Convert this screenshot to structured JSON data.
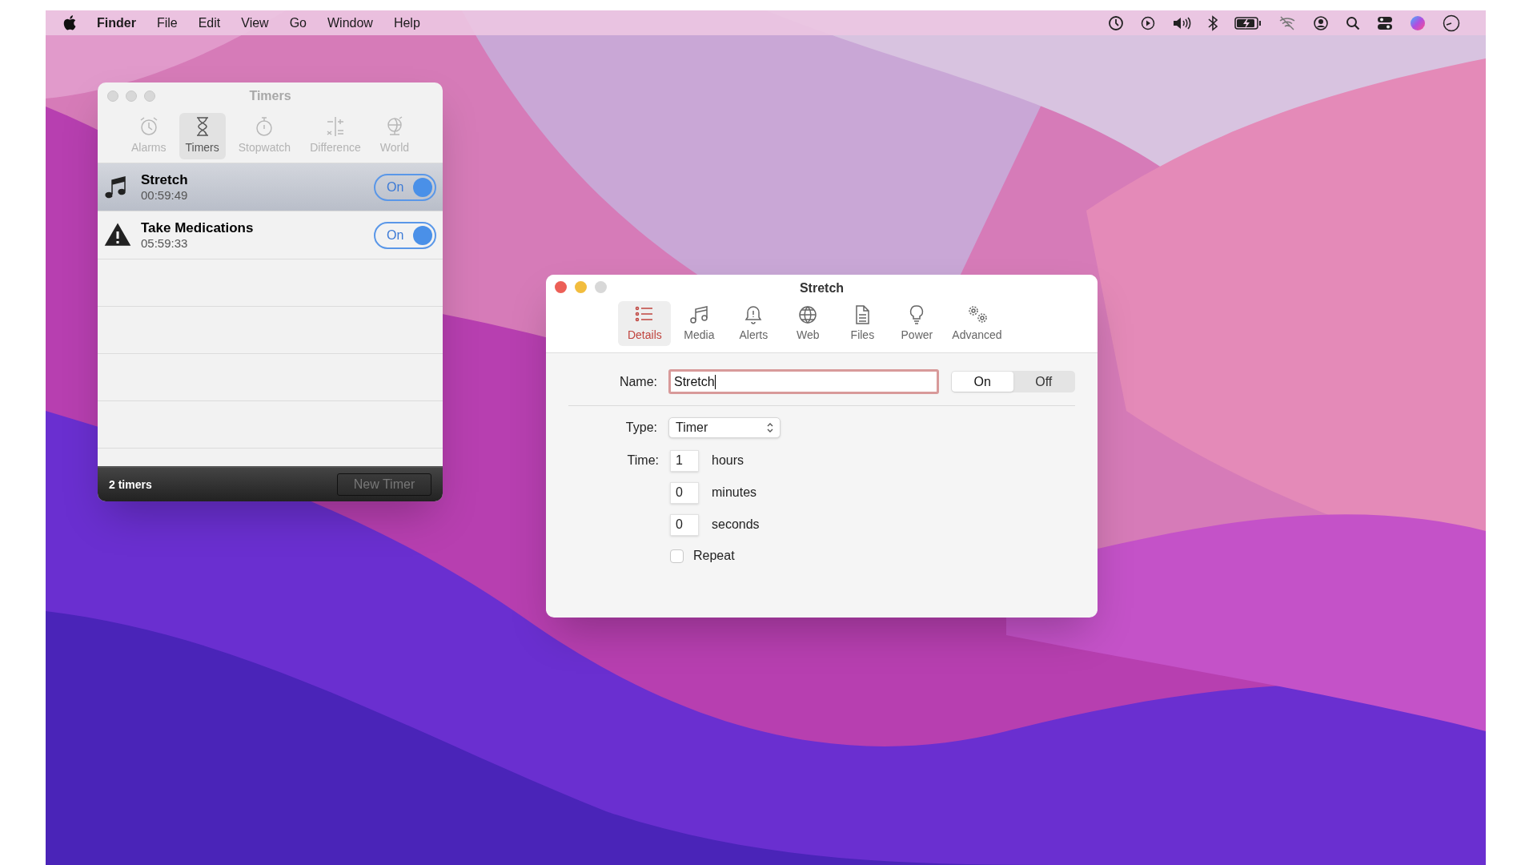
{
  "menu_bar": {
    "app_name": "Finder",
    "menus": [
      "File",
      "Edit",
      "View",
      "Go",
      "Window",
      "Help"
    ]
  },
  "timers_window": {
    "title": "Timers",
    "tabs": [
      {
        "label": "Alarms",
        "kind": "alarm",
        "selected": false
      },
      {
        "label": "Timers",
        "kind": "hourglass",
        "selected": true
      },
      {
        "label": "Stopwatch",
        "kind": "stopwatch",
        "selected": false
      },
      {
        "label": "Difference",
        "kind": "difference",
        "selected": false
      },
      {
        "label": "World",
        "kind": "globe",
        "selected": false
      }
    ],
    "timers": [
      {
        "name": "Stretch",
        "time": "00:59:49",
        "kind": "music",
        "selected": true,
        "on": true,
        "toggle_label": "On"
      },
      {
        "name": "Take Medications",
        "time": "05:59:33",
        "kind": "warning",
        "selected": false,
        "on": true,
        "toggle_label": "On"
      }
    ],
    "footer": {
      "count": "2 timers",
      "button": "New Timer",
      "button_disabled": true
    }
  },
  "detail_window": {
    "title": "Stretch",
    "tabs": [
      {
        "label": "Details",
        "kind": "list",
        "selected": true
      },
      {
        "label": "Media",
        "kind": "music",
        "selected": false
      },
      {
        "label": "Alerts",
        "kind": "bell",
        "selected": false
      },
      {
        "label": "Web",
        "kind": "globe",
        "selected": false
      },
      {
        "label": "Files",
        "kind": "file",
        "selected": false
      },
      {
        "label": "Power",
        "kind": "bulb",
        "selected": false
      },
      {
        "label": "Advanced",
        "kind": "gears",
        "selected": false
      }
    ],
    "name_label": "Name:",
    "name_value": "Stretch",
    "state_options": [
      {
        "label": "On",
        "selected": true
      },
      {
        "label": "Off",
        "selected": false
      }
    ],
    "type_label": "Type:",
    "type_value": "Timer",
    "time_label": "Time:",
    "time_fields": [
      {
        "value": "1",
        "unit": "hours"
      },
      {
        "value": "0",
        "unit": "minutes"
      },
      {
        "value": "0",
        "unit": "seconds"
      }
    ],
    "repeat": {
      "label": "Repeat",
      "checked": false
    }
  }
}
